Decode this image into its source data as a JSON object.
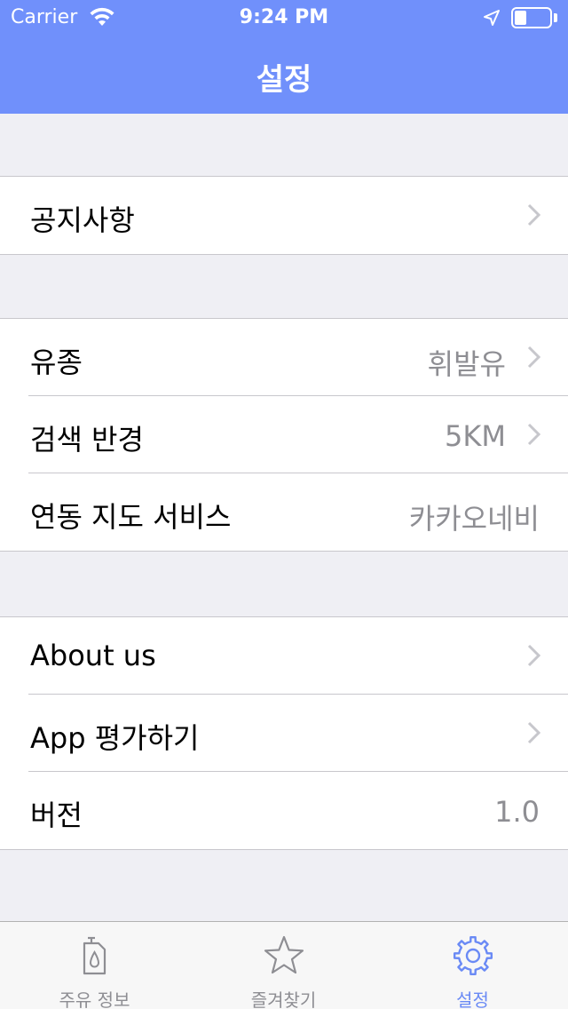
{
  "status_bar": {
    "carrier": "Carrier",
    "time": "9:24 PM",
    "battery_level": 0.35
  },
  "nav": {
    "title": "설정"
  },
  "sections": {
    "notice": {
      "label": "공지사항"
    },
    "fuel_type": {
      "label": "유종",
      "value": "휘발유"
    },
    "radius": {
      "label": "검색 반경",
      "value": "5KM"
    },
    "map_service": {
      "label": "연동 지도 서비스",
      "value": "카카오네비"
    },
    "about": {
      "label": "About us"
    },
    "rate": {
      "label": "App 평가하기"
    },
    "version": {
      "label": "버전",
      "value": "1.0"
    }
  },
  "tabbar": {
    "tabs": [
      {
        "label": "주유 정보",
        "icon": "fuel-icon"
      },
      {
        "label": "즐겨찾기",
        "icon": "star-icon"
      },
      {
        "label": "설정",
        "icon": "gear-icon"
      }
    ],
    "active_color": "#6a8af5",
    "inactive_color": "#8e8e93"
  },
  "colors": {
    "header": "#7090fb",
    "background": "#efeff4"
  }
}
